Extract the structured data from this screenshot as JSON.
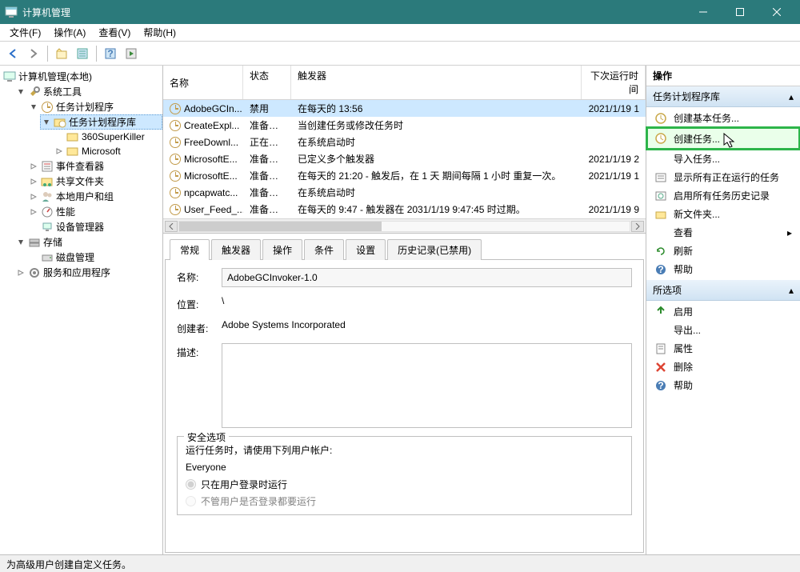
{
  "window": {
    "title": "计算机管理"
  },
  "menu": {
    "file": "文件(F)",
    "action": "操作(A)",
    "view": "查看(V)",
    "help": "帮助(H)"
  },
  "tree": {
    "root": "计算机管理(本地)",
    "systools": "系统工具",
    "tasksched": "任务计划程序",
    "tasklib": "任务计划程序库",
    "folder360": "360SuperKiller",
    "folderms": "Microsoft",
    "eventviewer": "事件查看器",
    "sharedfolders": "共享文件夹",
    "localusers": "本地用户和组",
    "performance": "性能",
    "devmgr": "设备管理器",
    "storage": "存储",
    "diskmgmt": "磁盘管理",
    "services": "服务和应用程序"
  },
  "columns": {
    "name": "名称",
    "status": "状态",
    "triggers": "触发器",
    "nextrun": "下次运行时间"
  },
  "tasks": [
    {
      "name": "AdobeGCIn...",
      "status": "禁用",
      "trigger": "在每天的 13:56",
      "nextrun": "2021/1/19 1",
      "sel": true
    },
    {
      "name": "CreateExpl...",
      "status": "准备就绪",
      "trigger": "当创建任务或修改任务时",
      "nextrun": ""
    },
    {
      "name": "FreeDownl...",
      "status": "正在运行",
      "trigger": "在系统启动时",
      "nextrun": ""
    },
    {
      "name": "MicrosoftE...",
      "status": "准备就绪",
      "trigger": "已定义多个触发器",
      "nextrun": "2021/1/19 2"
    },
    {
      "name": "MicrosoftE...",
      "status": "准备就绪",
      "trigger": "在每天的 21:20 - 触发后，在 1 天 期间每隔 1 小时 重复一次。",
      "nextrun": "2021/1/19 1"
    },
    {
      "name": "npcapwatc...",
      "status": "准备就绪",
      "trigger": "在系统启动时",
      "nextrun": ""
    },
    {
      "name": "User_Feed_...",
      "status": "准备就绪",
      "trigger": "在每天的 9:47 - 触发器在 2031/1/19 9:47:45 时过期。",
      "nextrun": "2021/1/19 9"
    }
  ],
  "tabs": {
    "general": "常规",
    "triggers": "触发器",
    "actions": "操作",
    "conditions": "条件",
    "settings": "设置",
    "history": "历史记录(已禁用)"
  },
  "detail": {
    "labels": {
      "name": "名称:",
      "location": "位置:",
      "creator": "创建者:",
      "description": "描述:",
      "security": "安全选项",
      "runuser": "运行任务时，请使用下列用户帐户:",
      "radio1": "只在用户登录时运行",
      "radio2": "不管用户是否登录都要运行"
    },
    "name": "AdobeGCInvoker-1.0",
    "location": "\\",
    "creator": "Adobe Systems Incorporated",
    "description": "",
    "account": "Everyone"
  },
  "actions": {
    "header": "操作",
    "group1": "任务计划程序库",
    "items1": [
      {
        "label": "创建基本任务...",
        "icon": "basic"
      },
      {
        "label": "创建任务...",
        "icon": "task",
        "hl": true
      },
      {
        "label": "导入任务...",
        "icon": "none"
      },
      {
        "label": "显示所有正在运行的任务",
        "icon": "list"
      },
      {
        "label": "启用所有任务历史记录",
        "icon": "history"
      },
      {
        "label": "新文件夹...",
        "icon": "folder"
      },
      {
        "label": "查看",
        "icon": "none",
        "sub": true
      },
      {
        "label": "刷新",
        "icon": "refresh"
      },
      {
        "label": "帮助",
        "icon": "help"
      }
    ],
    "group2": "所选项",
    "items2": [
      {
        "label": "启用",
        "icon": "enable"
      },
      {
        "label": "导出...",
        "icon": "none"
      },
      {
        "label": "属性",
        "icon": "props"
      },
      {
        "label": "删除",
        "icon": "delete"
      },
      {
        "label": "帮助",
        "icon": "help"
      }
    ]
  },
  "status": "为高级用户创建自定义任务。"
}
